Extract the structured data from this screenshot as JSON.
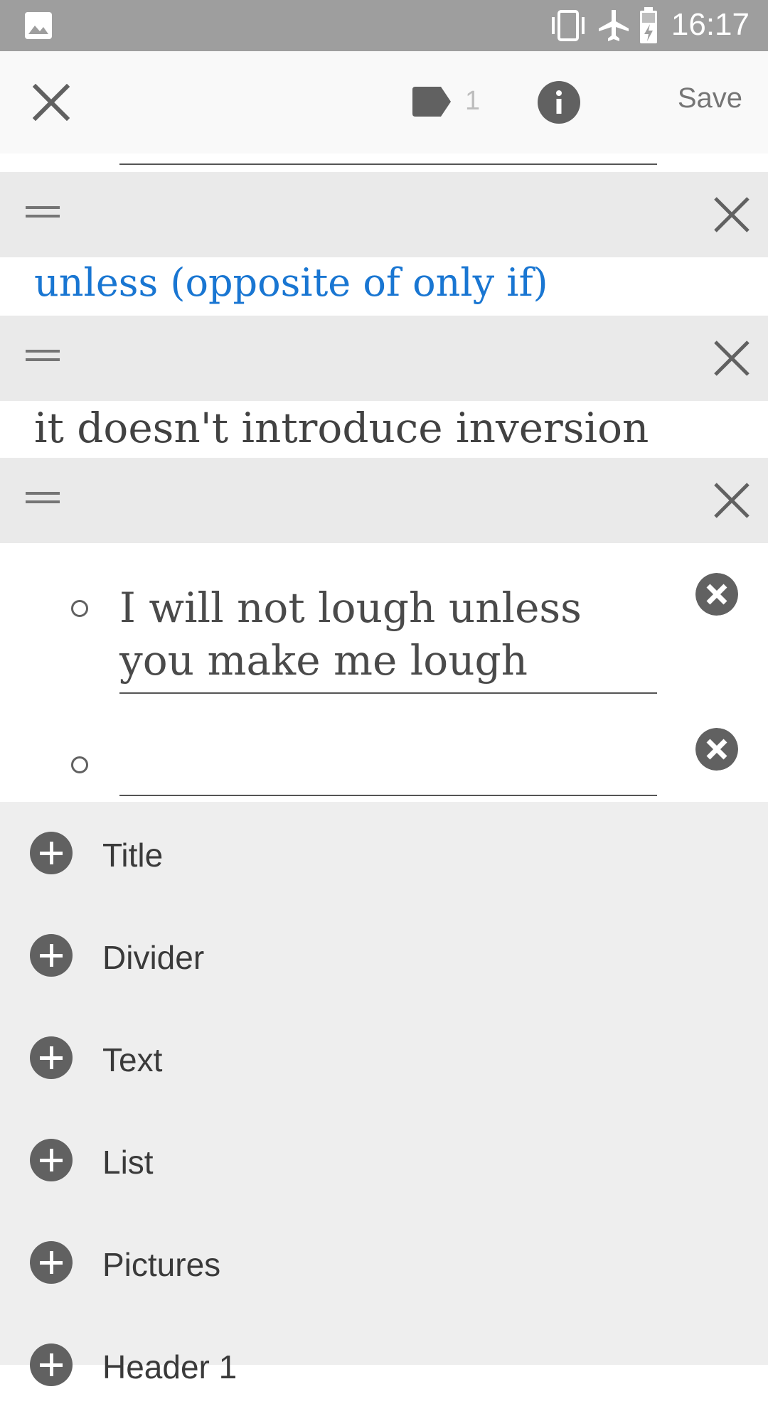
{
  "status_bar": {
    "time": "16:17",
    "icons": [
      "image-icon",
      "vibrate-icon",
      "airplane-icon",
      "battery-charging-icon"
    ]
  },
  "toolbar": {
    "close_icon": "close-icon",
    "tag_icon": "label-icon",
    "tag_count": "1",
    "info_icon": "info-icon",
    "save_label": "Save"
  },
  "blocks": {
    "title_block": {
      "text": "unless (opposite of only if)"
    },
    "text_block": {
      "text": "it doesn't introduce inversion"
    },
    "list_block": {
      "items": [
        {
          "text": "I will not lough unless you make me lough"
        },
        {
          "text": ""
        }
      ]
    }
  },
  "add_panel": {
    "items": [
      {
        "label": "Title"
      },
      {
        "label": "Divider"
      },
      {
        "label": "Text"
      },
      {
        "label": "List"
      },
      {
        "label": "Pictures"
      },
      {
        "label": "Header 1"
      }
    ]
  },
  "colors": {
    "accent": "#1976d2",
    "status_bar": "#9e9e9e",
    "header_bg": "#eaeaea",
    "panel_bg": "#eeeeee"
  }
}
